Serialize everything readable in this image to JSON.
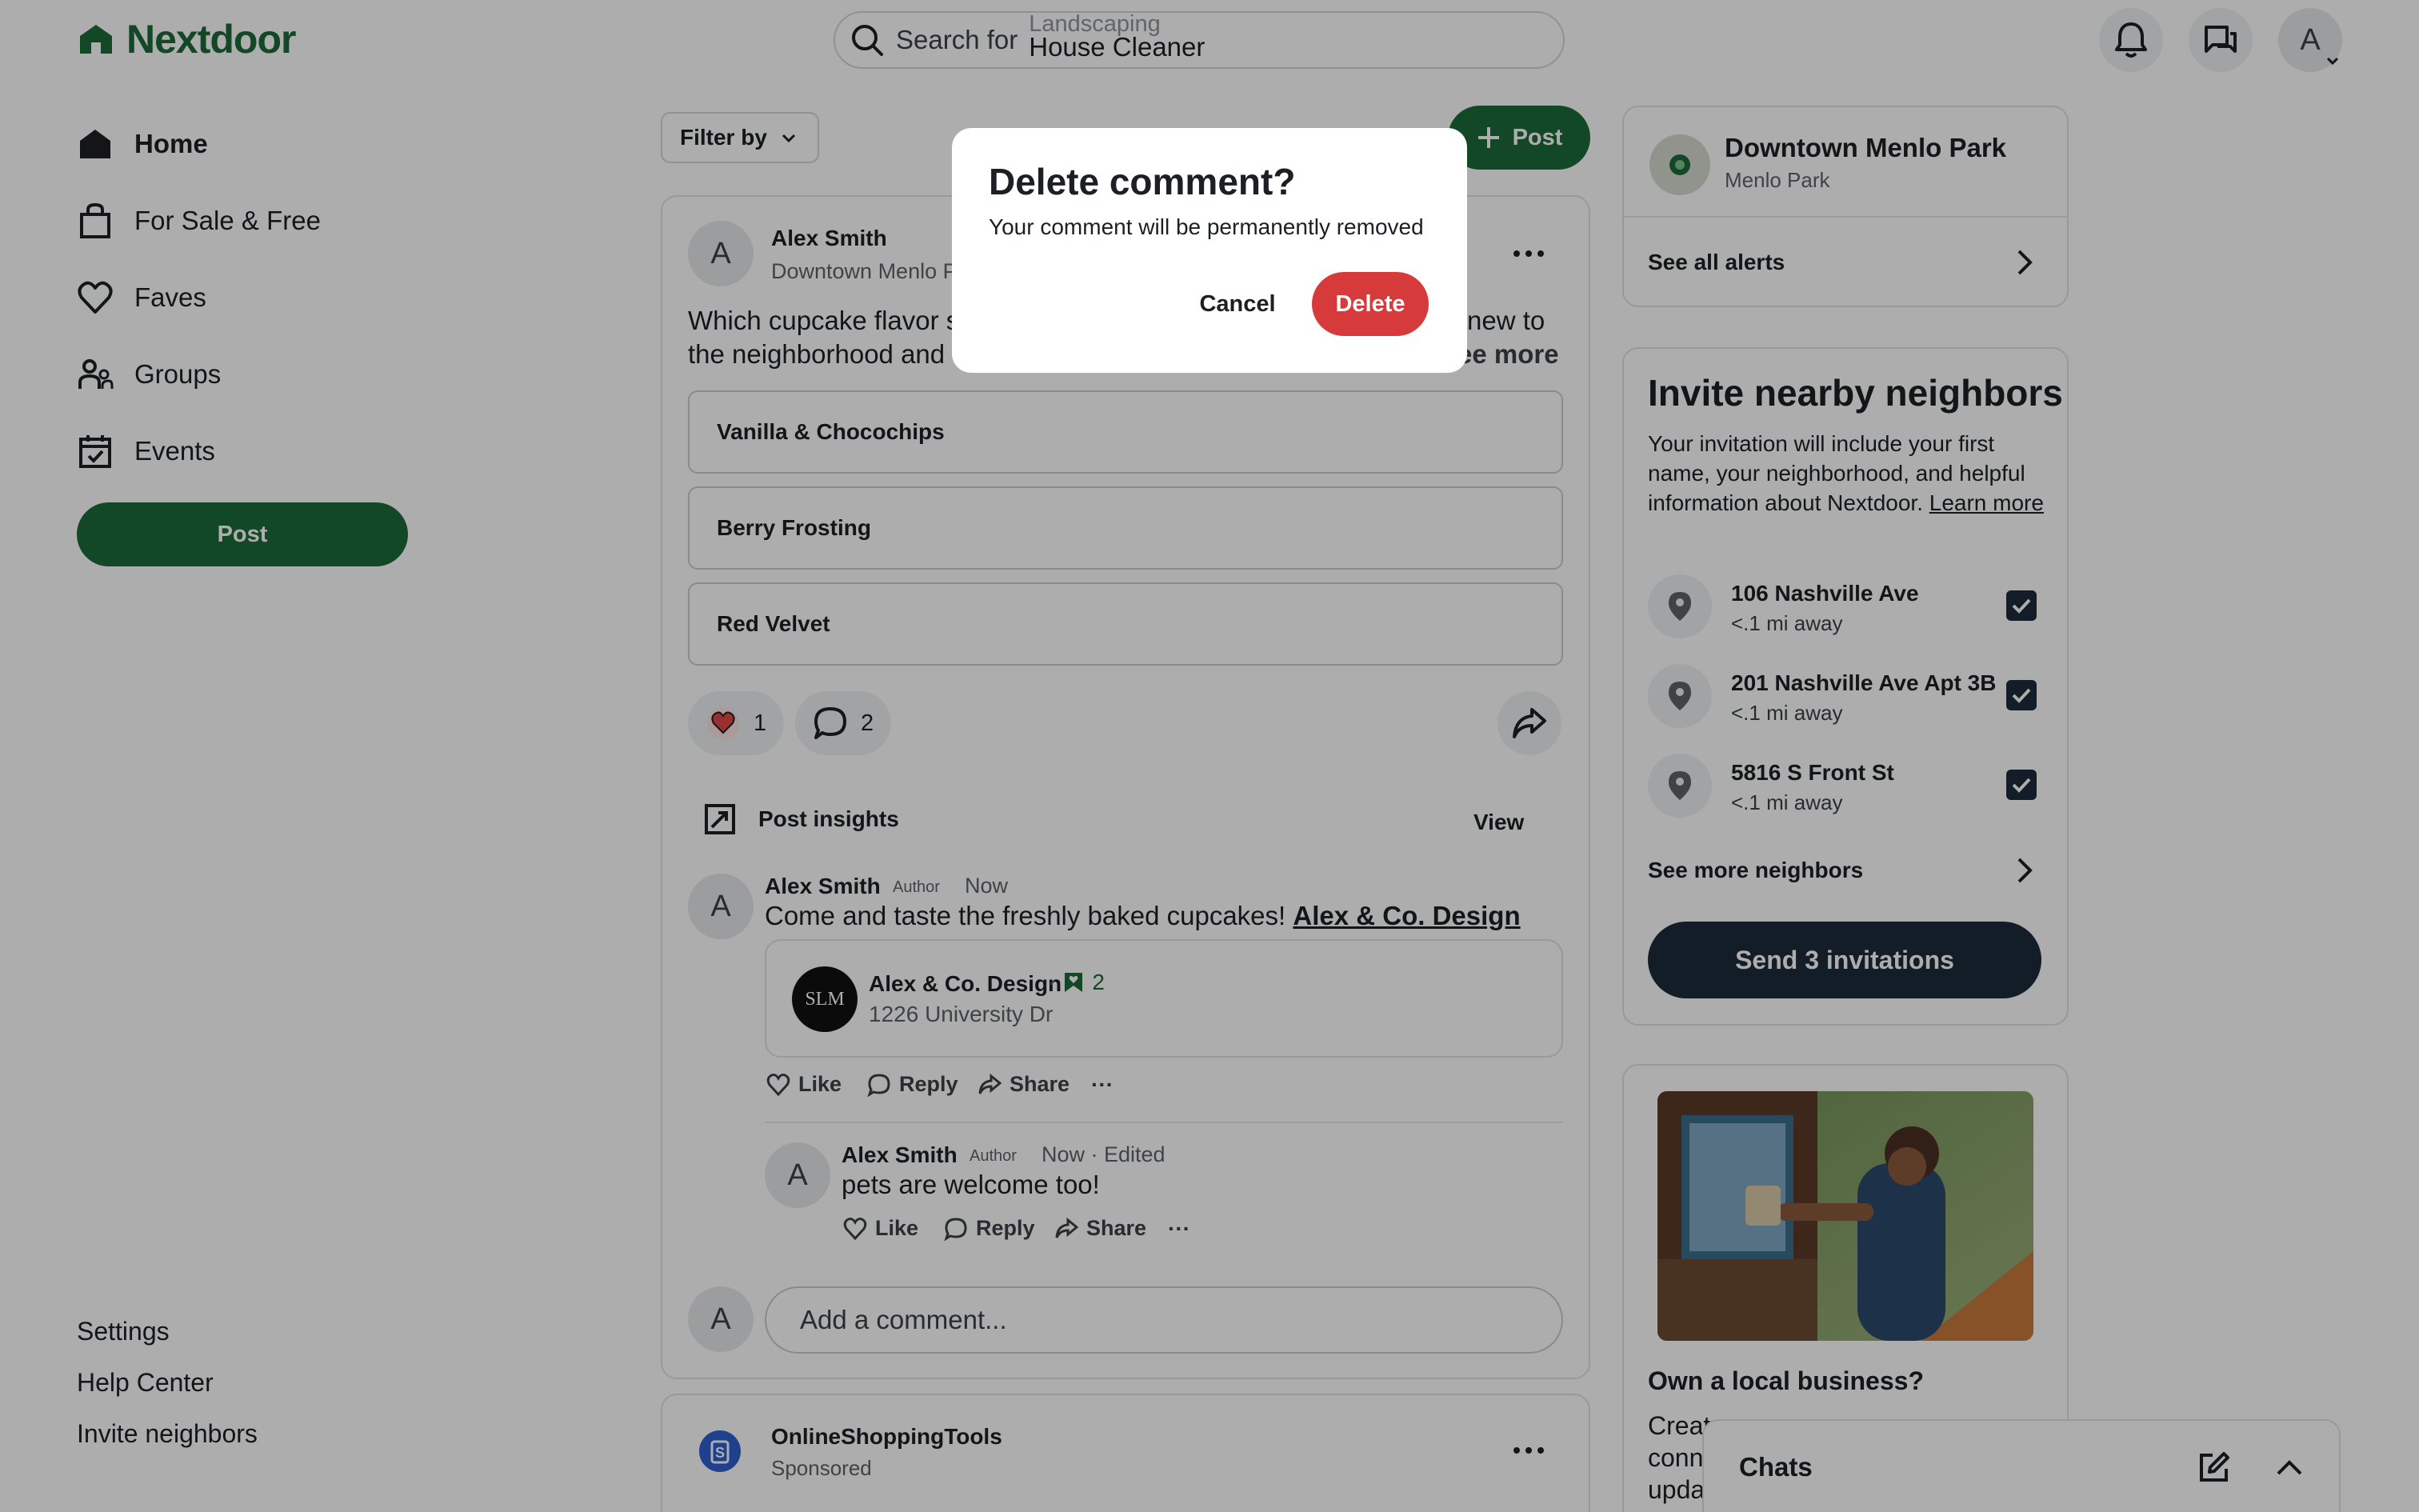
{
  "brand": {
    "name": "Nextdoor",
    "color": "#1d6b39"
  },
  "search": {
    "prefix": "Search for",
    "rotating_top": "Landscaping",
    "rotating_current": "House Cleaner"
  },
  "header": {
    "avatar_letter": "A"
  },
  "nav": {
    "items": [
      {
        "label": "Home",
        "icon": "home-icon",
        "active": true
      },
      {
        "label": "For Sale & Free",
        "icon": "bag-icon"
      },
      {
        "label": "Faves",
        "icon": "heart-icon"
      },
      {
        "label": "Groups",
        "icon": "groups-icon"
      },
      {
        "label": "Events",
        "icon": "calendar-icon"
      }
    ],
    "post_label": "Post",
    "footer": [
      "Settings",
      "Help Center",
      "Invite neighbors"
    ]
  },
  "feed": {
    "filter_label": "Filter by",
    "post_label": "Post",
    "post": {
      "author": "Alex Smith",
      "location": "Downtown Menlo P",
      "avatar_letter": "A",
      "text_left": "Which cupcake flavor s",
      "text_right": "new to",
      "text_line2_left": "the neighborhood and",
      "see_more": "ee more",
      "poll_options": [
        "Vanilla & Chocochips",
        "Berry Frosting",
        "Red Velvet"
      ],
      "reactions_count": "1",
      "comments_count": "2",
      "insights_label": "Post insights",
      "insights_view": "View",
      "comments": [
        {
          "author": "Alex Smith",
          "badge": "Author",
          "time": "Now",
          "text": "Come and taste the freshly baked cupcakes!",
          "mention": "Alex & Co. Design",
          "business": {
            "logo_text": "SLM",
            "name": "Alex & Co. Design",
            "faves": "2",
            "address": "1226 University Dr"
          },
          "actions": [
            "Like",
            "Reply",
            "Share"
          ]
        },
        {
          "author": "Alex Smith",
          "badge": "Author",
          "time": "Now · Edited",
          "text": "pets are welcome too!",
          "actions": [
            "Like",
            "Reply",
            "Share"
          ]
        }
      ],
      "add_comment_placeholder": "Add a comment..."
    },
    "sponsored": {
      "name": "OnlineShoppingTools",
      "label": "Sponsored"
    }
  },
  "right": {
    "neighborhood": {
      "name": "Downtown Menlo Park",
      "city": "Menlo Park",
      "alerts_link": "See all alerts"
    },
    "invite": {
      "title": "Invite nearby neighbors",
      "description": "Your invitation will include your first name, your neighborhood, and helpful information about Nextdoor.",
      "learn_more": "Learn more",
      "addresses": [
        {
          "street": "106 Nashville Ave",
          "distance": "<.1 mi away",
          "checked": true
        },
        {
          "street": "201 Nashville Ave Apt 3B",
          "distance": "<.1 mi away",
          "checked": true
        },
        {
          "street": "5816 S Front St",
          "distance": "<.1 mi away",
          "checked": true
        }
      ],
      "see_more": "See more neighbors",
      "send_label": "Send 3 invitations"
    },
    "business": {
      "title": "Own a local business?",
      "text_lines": [
        "Creat",
        "conn",
        "upda"
      ]
    }
  },
  "modal": {
    "title": "Delete comment?",
    "message": "Your comment will be permanently removed",
    "cancel_label": "Cancel",
    "delete_label": "Delete",
    "delete_color": "#d63a3a"
  },
  "chats": {
    "label": "Chats"
  }
}
